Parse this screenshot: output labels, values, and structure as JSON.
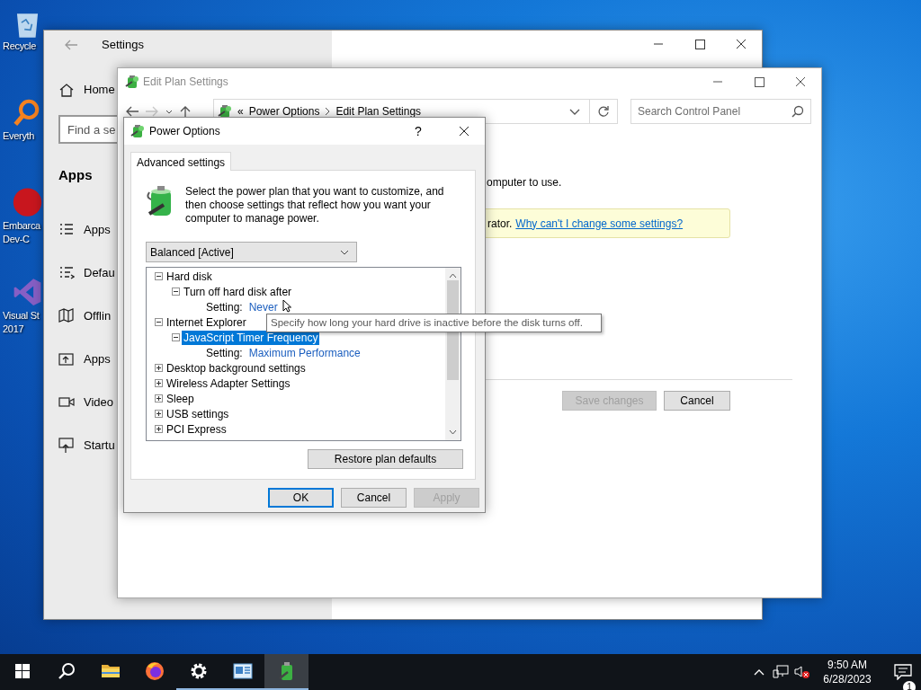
{
  "desktop_icons": [
    {
      "kind": "recycle",
      "lines": [
        "Recycle"
      ]
    },
    {
      "kind": "everything",
      "lines": [
        "Everyth"
      ]
    },
    {
      "kind": "devcpp",
      "lines": [
        "Embarca",
        "Dev-C"
      ]
    },
    {
      "kind": "vstudio",
      "lines": [
        "Visual St",
        "2017"
      ]
    }
  ],
  "settings_window": {
    "title": "Settings",
    "home": "Home",
    "search": {
      "placeholder": "Find a se"
    },
    "heading": "Apps",
    "items": [
      {
        "label": "Apps"
      },
      {
        "label": "Defau"
      },
      {
        "label": "Offlin"
      },
      {
        "label": "Apps"
      },
      {
        "label": "Video"
      },
      {
        "label": "Startu"
      }
    ]
  },
  "edit_plan_window": {
    "title": "Edit Plan Settings",
    "active": false,
    "overflow": "«",
    "breadcrumb": [
      "Power Options",
      "Edit Plan Settings"
    ],
    "search": {
      "placeholder": "Search Control Panel"
    },
    "description": "omputer to use.",
    "notice": {
      "text": "rator.",
      "link": "Why can't I change some settings?"
    },
    "buttons": [
      {
        "label": "Save changes",
        "disabled": true
      },
      {
        "label": "Cancel",
        "disabled": false
      }
    ]
  },
  "dialog": {
    "title": "Power Options",
    "help": "?",
    "tabs": [
      {
        "label": "Advanced settings",
        "selected": true
      }
    ],
    "intro": "Select the power plan that you want to customize, and then choose settings that reflect how you want your computer to manage power.",
    "plan_select": {
      "value": "Balanced [Active]"
    },
    "tree": [
      {
        "kind": "group",
        "label": "Hard disk",
        "expanded": true,
        "selected": false,
        "children": [
          {
            "kind": "group",
            "label": "Turn off hard disk after",
            "expanded": true,
            "selected": false,
            "children": [
              {
                "kind": "setting",
                "label": "Setting:",
                "value": "Never",
                "selected": false
              }
            ]
          }
        ]
      },
      {
        "kind": "group",
        "label": "Internet Explorer",
        "expanded": true,
        "selected": false,
        "children": [
          {
            "kind": "group",
            "label": "JavaScript Timer Frequency",
            "expanded": true,
            "selected": true,
            "children": [
              {
                "kind": "setting",
                "label": "Setting:",
                "value": "Maximum Performance",
                "selected": false
              }
            ]
          }
        ]
      },
      {
        "kind": "group",
        "label": "Desktop background settings",
        "expanded": false,
        "selected": false
      },
      {
        "kind": "group",
        "label": "Wireless Adapter Settings",
        "expanded": false,
        "selected": false
      },
      {
        "kind": "group",
        "label": "Sleep",
        "expanded": false,
        "selected": false
      },
      {
        "kind": "group",
        "label": "USB settings",
        "expanded": false,
        "selected": false
      },
      {
        "kind": "group",
        "label": "PCI Express",
        "expanded": false,
        "selected": false
      }
    ],
    "tooltip": "Specify how long your hard drive is inactive before the disk turns off.",
    "restore_button": "Restore plan defaults",
    "buttons": [
      {
        "label": "OK",
        "default": true,
        "disabled": false
      },
      {
        "label": "Cancel",
        "default": false,
        "disabled": false
      },
      {
        "label": "Apply",
        "default": false,
        "disabled": true
      }
    ]
  },
  "taskbar": {
    "apps": [
      {
        "kind": "explorer",
        "running": false,
        "active": false
      },
      {
        "kind": "firefox",
        "running": false,
        "active": false
      },
      {
        "kind": "settings",
        "running": true,
        "active": false
      },
      {
        "kind": "control",
        "running": true,
        "active": false
      },
      {
        "kind": "power",
        "running": true,
        "active": true
      }
    ],
    "time": "9:50 AM",
    "date": "6/28/2023",
    "notifications": "1"
  }
}
